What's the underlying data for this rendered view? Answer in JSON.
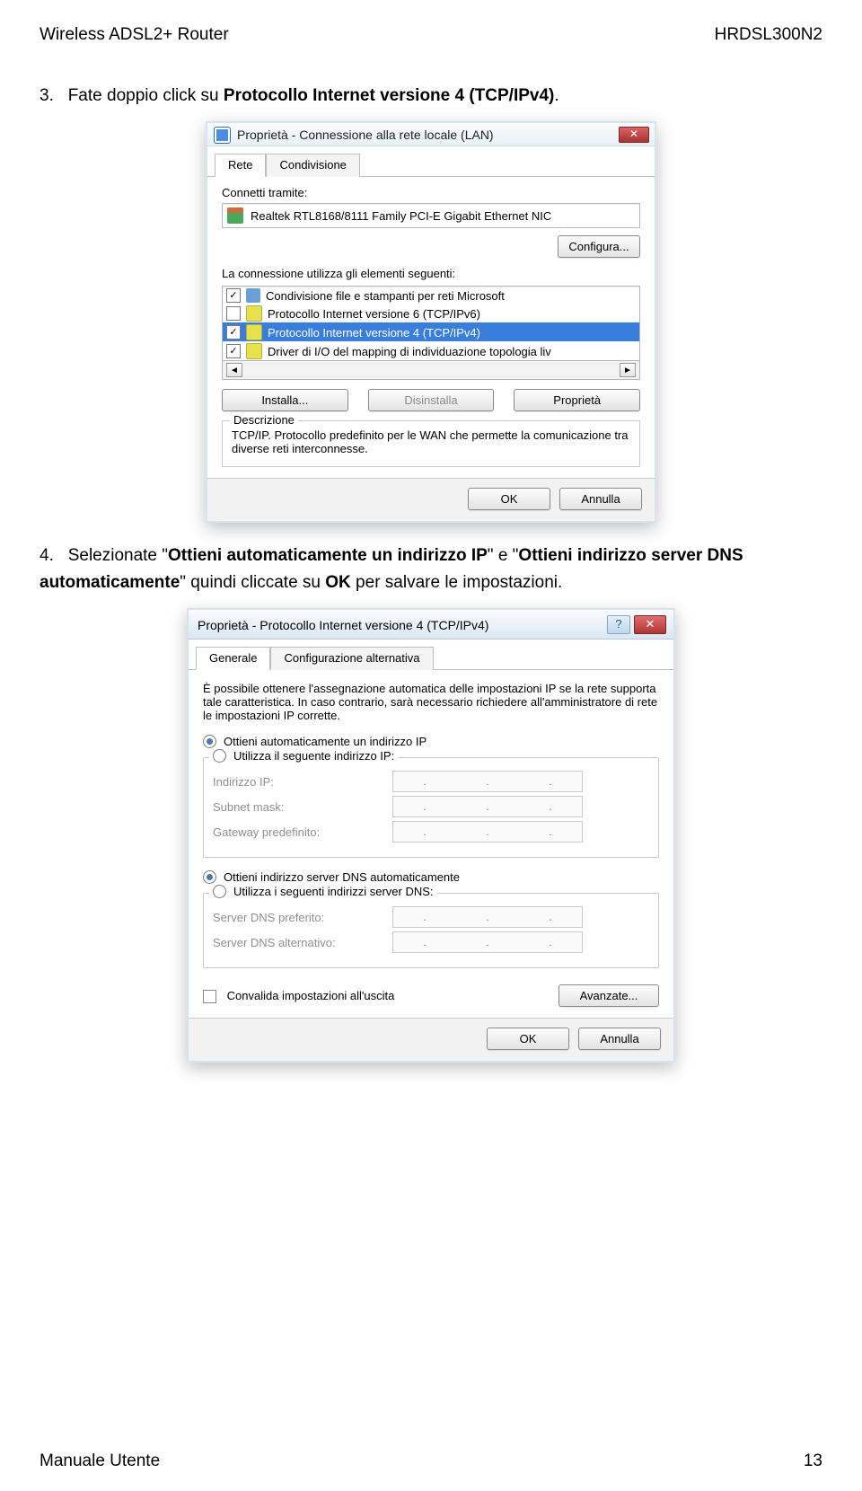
{
  "header": {
    "left": "Wireless ADSL2+ Router",
    "right": "HRDSL300N2"
  },
  "step3": {
    "num": "3.",
    "pre": "Fate doppio click su ",
    "bold": "Protocollo Internet versione 4 (TCP/IPv4)",
    "post": "."
  },
  "dlg1": {
    "title": "Proprietà - Connessione alla rete locale (LAN)",
    "tabs": {
      "active": "Rete",
      "other": "Condivisione"
    },
    "connect_via": "Connetti tramite:",
    "nic": "Realtek RTL8168/8111 Family PCI-E Gigabit Ethernet NIC",
    "configure": "Configura...",
    "uses": "La connessione utilizza gli elementi seguenti:",
    "items": [
      {
        "check": true,
        "ic": "share",
        "label": "Condivisione file e stampanti per reti Microsoft"
      },
      {
        "check": false,
        "ic": "proto",
        "label": "Protocollo Internet versione 6 (TCP/IPv6)"
      },
      {
        "check": true,
        "ic": "proto",
        "label": "Protocollo Internet versione 4 (TCP/IPv4)",
        "sel": true
      },
      {
        "check": true,
        "ic": "proto",
        "label": "Driver di I/O del mapping di individuazione topologia liv"
      }
    ],
    "install": "Installa...",
    "uninstall": "Disinstalla",
    "properties": "Proprietà",
    "desc_head": "Descrizione",
    "desc": "TCP/IP. Protocollo predefinito per le WAN che permette la comunicazione tra diverse reti interconnesse.",
    "ok": "OK",
    "cancel": "Annulla"
  },
  "step4": {
    "num": "4.",
    "a": "Selezionate \"",
    "b": "Ottieni automaticamente un indirizzo IP",
    "c": "\" e \"",
    "d": "Ottieni indirizzo server DNS automaticamente",
    "e": "\" quindi cliccate su ",
    "f": "OK",
    "g": " per salvare le impostazioni."
  },
  "dlg2": {
    "title": "Proprietà - Protocollo Internet versione 4 (TCP/IPv4)",
    "tabs": {
      "active": "Generale",
      "other": "Configurazione alternativa"
    },
    "intro": "È possibile ottenere l'assegnazione automatica delle impostazioni IP se la rete supporta tale caratteristica. In caso contrario, sarà necessario richiedere all'amministratore di rete le impostazioni IP corrette.",
    "r1": "Ottieni automaticamente un indirizzo IP",
    "r2": "Utilizza il seguente indirizzo IP:",
    "ip": "Indirizzo IP:",
    "mask": "Subnet mask:",
    "gw": "Gateway predefinito:",
    "r3": "Ottieni indirizzo server DNS automaticamente",
    "r4": "Utilizza i seguenti indirizzi server DNS:",
    "dns1": "Server DNS preferito:",
    "dns2": "Server DNS alternativo:",
    "validate": "Convalida impostazioni all'uscita",
    "advanced": "Avanzate...",
    "ok": "OK",
    "cancel": "Annulla"
  },
  "footer": {
    "left": "Manuale Utente",
    "right": "13"
  }
}
